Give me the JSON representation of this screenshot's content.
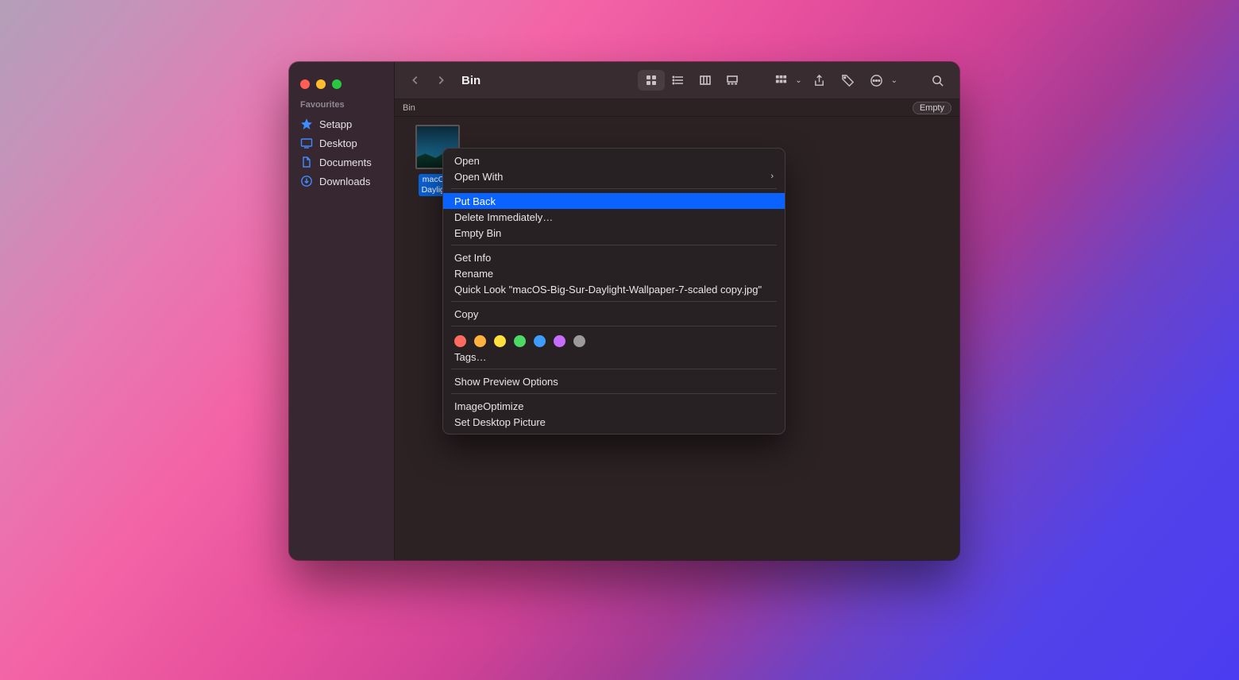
{
  "window": {
    "title": "Bin"
  },
  "sidebar": {
    "section": "Favourites",
    "items": [
      {
        "label": "Setapp"
      },
      {
        "label": "Desktop"
      },
      {
        "label": "Documents"
      },
      {
        "label": "Downloads"
      }
    ]
  },
  "pathbar": {
    "location": "Bin",
    "empty_label": "Empty"
  },
  "file": {
    "name_line1": "macOS-",
    "name_line2": "Daylight."
  },
  "context_menu": {
    "open": "Open",
    "open_with": "Open With",
    "put_back": "Put Back",
    "delete_immediately": "Delete Immediately…",
    "empty_bin": "Empty Bin",
    "get_info": "Get Info",
    "rename": "Rename",
    "quick_look": "Quick Look \"macOS-Big-Sur-Daylight-Wallpaper-7-scaled copy.jpg\"",
    "copy": "Copy",
    "tags": "Tags…",
    "show_preview": "Show Preview Options",
    "image_optimize": "ImageOptimize",
    "set_desktop": "Set Desktop Picture"
  }
}
